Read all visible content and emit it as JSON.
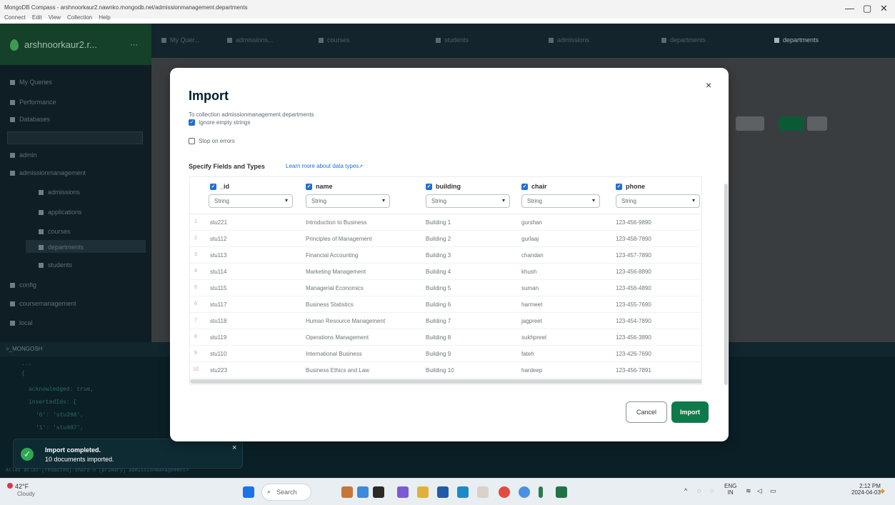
{
  "window": {
    "title": "MongoDB Compass - arshnoorkaur2.nawnko.mongodb.net/admissionmanagement.departments",
    "menu": [
      "Connect",
      "Edit",
      "View",
      "Collection",
      "Help"
    ],
    "controls": [
      "—",
      "▢",
      "✕"
    ]
  },
  "sidebar": {
    "connection_name": "arshnoorkaur2.r...",
    "items": [
      "My Queries",
      "Performance",
      "Databases",
      "admin",
      "admissionmanagement",
      "admissions",
      "applications",
      "courses",
      "departments",
      "students",
      "config",
      "coursemanagement",
      "local"
    ]
  },
  "tabs": [
    "My Quer...",
    "admissions...",
    "courses",
    "students",
    "admissions",
    "departments",
    "departments"
  ],
  "shell": {
    "title": ">_MONGOSH",
    "lines": [
      "...",
      "{",
      "acknowledged: true,",
      "insertedIds: {",
      "'0': 'stu298',",
      "'1': 'stu987',"
    ],
    "command": "Atlas atlas-[redacted]-shard-0 [primary] admissionmanagement>"
  },
  "modal": {
    "title": "Import",
    "close": "×",
    "collection_text": "To collection admissionmanagement.departments",
    "ignore_empty": "Ignore empty strings",
    "stop_on_errors": "Stop on errors",
    "specify_label": "Specify Fields and Types",
    "learn_more": "Learn more about data types",
    "fields": [
      {
        "name": "_id",
        "type": "String"
      },
      {
        "name": "name",
        "type": "String"
      },
      {
        "name": "building",
        "type": "String"
      },
      {
        "name": "chair",
        "type": "String"
      },
      {
        "name": "phone",
        "type": "String"
      }
    ],
    "rows": [
      {
        "n": "1",
        "id": "stu221",
        "name": "Introduction to Business",
        "building": "Building 1",
        "chair": "gurshan",
        "phone": "123-456-9890"
      },
      {
        "n": "2",
        "id": "stu112",
        "name": "Principles of Management",
        "building": "Building 2",
        "chair": "gurlaaj",
        "phone": "123-458-7890"
      },
      {
        "n": "3",
        "id": "stu113",
        "name": "Financial Accounting",
        "building": "Building 3",
        "chair": "chandan",
        "phone": "123-457-7890"
      },
      {
        "n": "4",
        "id": "stu114",
        "name": "Marketing Management",
        "building": "Building 4",
        "chair": "khush",
        "phone": "123-456-8890"
      },
      {
        "n": "5",
        "id": "stu115",
        "name": "Managerial Economics",
        "building": "Building 5",
        "chair": "suman",
        "phone": "123-456-4890"
      },
      {
        "n": "6",
        "id": "stu117",
        "name": "Business Statistics",
        "building": "Building 6",
        "chair": "harmeet",
        "phone": "123-455-7690"
      },
      {
        "n": "7",
        "id": "stu118",
        "name": "Human Resource Management",
        "building": "Building 7",
        "chair": "jagpreet",
        "phone": "123-454-7890"
      },
      {
        "n": "8",
        "id": "stu119",
        "name": "Operations Management",
        "building": "Building 8",
        "chair": "sukhpreet",
        "phone": "123-456-3890"
      },
      {
        "n": "9",
        "id": "stu110",
        "name": "International Business",
        "building": "Building 9",
        "chair": "fateh",
        "phone": "123-426-7690"
      },
      {
        "n": "10",
        "id": "stu223",
        "name": "Business Ethics and Law",
        "building": "Building 10",
        "chair": "hardeep",
        "phone": "123-456-7891"
      }
    ],
    "cancel": "Cancel",
    "import": "Import"
  },
  "toast": {
    "title": "Import completed.",
    "body": "10 documents imported.",
    "close": "×"
  },
  "taskbar": {
    "temp": "42°F",
    "weather": "Cloudy",
    "search": "Search",
    "lang_top": "ENG",
    "lang_bottom": "IN",
    "time": "2:12 PM",
    "date": "2024-04-03"
  },
  "colors": {
    "accent_green": "#0e7a4c",
    "checkbox_blue": "#1e6fd6",
    "toast_success": "#2fa84f"
  }
}
